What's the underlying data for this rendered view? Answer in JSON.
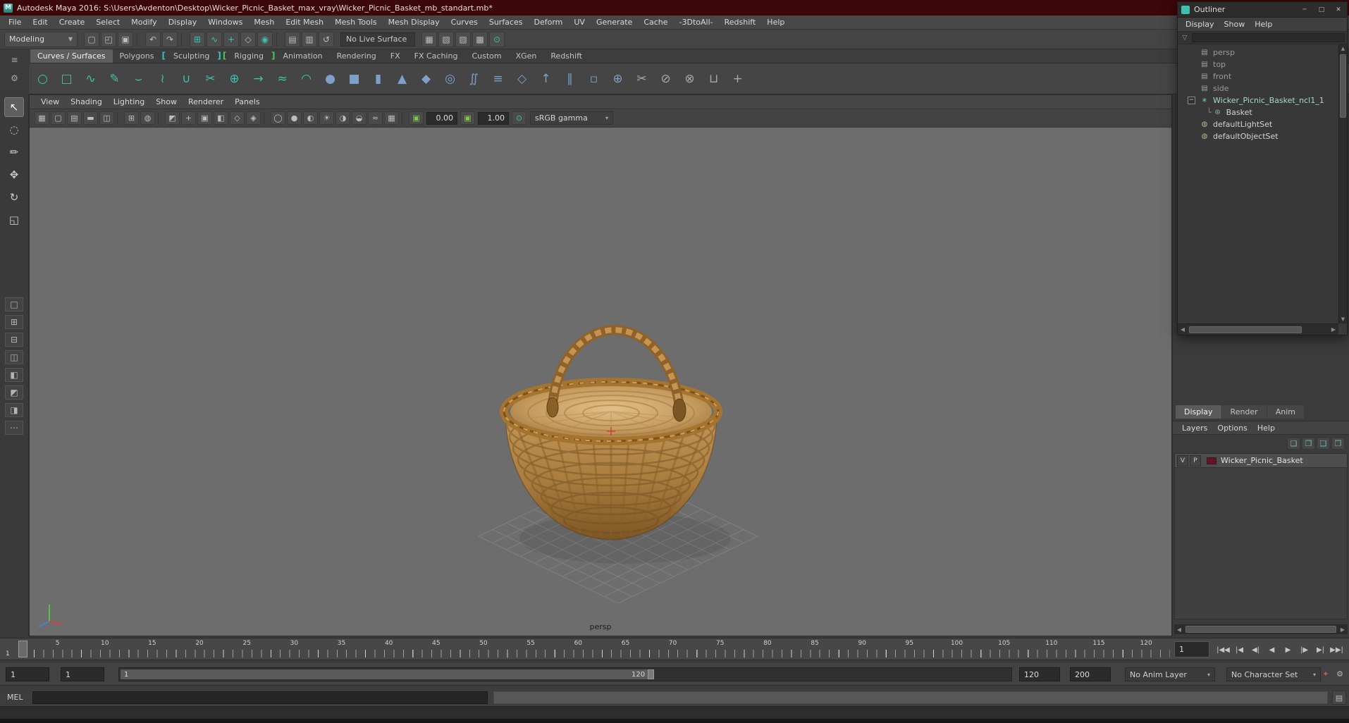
{
  "titlebar": {
    "title": "Autodesk Maya 2016: S:\\Users\\Avdenton\\Desktop\\Wicker_Picnic_Basket_max_vray\\Wicker_Picnic_Basket_mb_standart.mb*",
    "logo_glyph": "M"
  },
  "ui": {
    "dropdown_arrow": "▾",
    "select_arrow": "▼",
    "left_arrow": "◀",
    "right_arrow": "▶",
    "up_arrow": "▲",
    "down_arrow": "▼"
  },
  "colors": {
    "accent_teal": "#3fbfae",
    "titlebar_red": "#3c0708",
    "layer_swatch": "#6b1126",
    "viewport_bg": "#6d6d6d",
    "bracket_green": "#47c94f"
  },
  "menubar": [
    {
      "label": "File",
      "name": "menu-file"
    },
    {
      "label": "Edit",
      "name": "menu-edit"
    },
    {
      "label": "Create",
      "name": "menu-create"
    },
    {
      "label": "Select",
      "name": "menu-select"
    },
    {
      "label": "Modify",
      "name": "menu-modify"
    },
    {
      "label": "Display",
      "name": "menu-display"
    },
    {
      "label": "Windows",
      "name": "menu-windows"
    },
    {
      "label": "Mesh",
      "name": "menu-mesh"
    },
    {
      "label": "Edit Mesh",
      "name": "menu-edit-mesh"
    },
    {
      "label": "Mesh Tools",
      "name": "menu-mesh-tools"
    },
    {
      "label": "Mesh Display",
      "name": "menu-mesh-display"
    },
    {
      "label": "Curves",
      "name": "menu-curves"
    },
    {
      "label": "Surfaces",
      "name": "menu-surfaces"
    },
    {
      "label": "Deform",
      "name": "menu-deform"
    },
    {
      "label": "UV",
      "name": "menu-uv"
    },
    {
      "label": "Generate",
      "name": "menu-generate"
    },
    {
      "label": "Cache",
      "name": "menu-cache"
    },
    {
      "label": "-3DtoAll-",
      "name": "menu-3dtoall"
    },
    {
      "label": "Redshift",
      "name": "menu-redshift"
    },
    {
      "label": "Help",
      "name": "menu-help"
    }
  ],
  "statusline": {
    "mode": "Modeling",
    "live_surface": "No Live Surface",
    "icons": [
      {
        "name": "new-scene-icon",
        "glyph": "▢"
      },
      {
        "name": "open-scene-icon",
        "glyph": "◰"
      },
      {
        "name": "save-scene-icon",
        "glyph": "▣"
      },
      {
        "cls": "sep"
      },
      {
        "name": "undo-icon",
        "glyph": "↶"
      },
      {
        "name": "redo-icon",
        "glyph": "↷"
      },
      {
        "cls": "sep"
      },
      {
        "name": "snap-to-grid-icon",
        "glyph": "⊞",
        "cls": "teal"
      },
      {
        "name": "snap-to-curve-icon",
        "glyph": "∿",
        "cls": "teal"
      },
      {
        "name": "snap-to-point-icon",
        "glyph": "+",
        "cls": "teal"
      },
      {
        "name": "snap-to-view-plane-icon",
        "glyph": "◇"
      },
      {
        "name": "make-live-icon",
        "glyph": "◉",
        "cls": "teal"
      },
      {
        "cls": "sep"
      },
      {
        "name": "input-connections-icon",
        "glyph": "▤"
      },
      {
        "name": "output-connections-icon",
        "glyph": "▥"
      },
      {
        "name": "construction-history-icon",
        "glyph": "↺"
      }
    ],
    "right_icons": [
      {
        "name": "selection-mask-hierarchy-icon",
        "glyph": "▦"
      },
      {
        "name": "selection-mask-object-icon",
        "glyph": "▧"
      },
      {
        "name": "selection-mask-component-icon",
        "glyph": "▨"
      },
      {
        "name": "selection-mask-render-icon",
        "glyph": "▩"
      },
      {
        "name": "highlight-selection-icon",
        "glyph": "⊙",
        "cls": "teal"
      }
    ]
  },
  "shelf": {
    "gutter_icons": [
      {
        "name": "shelf-tab-menu-icon",
        "glyph": "≡"
      },
      {
        "name": "shelf-options-icon",
        "glyph": "⚙"
      }
    ],
    "tabs": [
      {
        "label": "Curves / Surfaces",
        "name": "shelf-tab-curves-surfaces",
        "cls": "active"
      },
      {
        "label": "Polygons",
        "name": "shelf-tab-polygons"
      },
      {
        "label": "[",
        "name": "shelf-bracket",
        "cls": "br teal"
      },
      {
        "label": "Sculpting",
        "name": "shelf-tab-sculpting"
      },
      {
        "label": "]",
        "name": "shelf-bracket",
        "cls": "br teal"
      },
      {
        "label": "[",
        "name": "shelf-bracket",
        "cls": "br green"
      },
      {
        "label": "Rigging",
        "name": "shelf-tab-rigging"
      },
      {
        "label": "]",
        "name": "shelf-bracket",
        "cls": "br green"
      },
      {
        "label": "Animation",
        "name": "shelf-tab-animation"
      },
      {
        "label": "Rendering",
        "name": "shelf-tab-rendering"
      },
      {
        "label": "FX",
        "name": "shelf-tab-fx"
      },
      {
        "label": "FX Caching",
        "name": "shelf-tab-fx-caching"
      },
      {
        "label": "Custom",
        "name": "shelf-tab-custom"
      },
      {
        "label": "XGen",
        "name": "shelf-tab-xgen"
      },
      {
        "label": "Redshift",
        "name": "shelf-tab-redshift"
      }
    ],
    "icons": [
      {
        "name": "nurbs-circle-icon",
        "glyph": "○",
        "cls": "teal"
      },
      {
        "name": "nurbs-square-icon",
        "glyph": "□",
        "cls": "teal"
      },
      {
        "name": "ep-curve-tool-icon",
        "glyph": "∿",
        "cls": "teal"
      },
      {
        "name": "pencil-curve-tool-icon",
        "glyph": "✎",
        "cls": "teal"
      },
      {
        "name": "bezier-curve-tool-icon",
        "glyph": "⌣",
        "cls": "teal"
      },
      {
        "name": "add-points-tool-icon",
        "glyph": "≀",
        "cls": "teal"
      },
      {
        "name": "attach-curves-icon",
        "glyph": "∪",
        "cls": "teal"
      },
      {
        "name": "detach-curves-icon",
        "glyph": "✂",
        "cls": "teal"
      },
      {
        "name": "insert-knot-icon",
        "glyph": "⊕",
        "cls": "teal"
      },
      {
        "name": "extend-curve-icon",
        "glyph": "→",
        "cls": "teal"
      },
      {
        "name": "offset-curve-icon",
        "glyph": "≈",
        "cls": "teal"
      },
      {
        "name": "curve-fillet-icon",
        "glyph": "◠",
        "cls": "teal"
      },
      {
        "name": "nurbs-sphere-icon",
        "glyph": "●",
        "cls": "blue"
      },
      {
        "name": "nurbs-cube-icon",
        "glyph": "■",
        "cls": "blue"
      },
      {
        "name": "nurbs-cylinder-icon",
        "glyph": "▮",
        "cls": "blue"
      },
      {
        "name": "nurbs-cone-icon",
        "glyph": "▲",
        "cls": "blue"
      },
      {
        "name": "nurbs-plane-icon",
        "glyph": "◆",
        "cls": "blue"
      },
      {
        "name": "nurbs-torus-icon",
        "glyph": "◎",
        "cls": "blue"
      },
      {
        "name": "revolve-icon",
        "glyph": "∬",
        "cls": "blue"
      },
      {
        "name": "loft-icon",
        "glyph": "≡",
        "cls": "blue"
      },
      {
        "name": "planar-icon",
        "glyph": "◇",
        "cls": "blue"
      },
      {
        "name": "extrude-surface-icon",
        "glyph": "↑",
        "cls": "blue"
      },
      {
        "name": "birail-icon",
        "glyph": "∥",
        "cls": "blue"
      },
      {
        "name": "boundary-icon",
        "glyph": "▫",
        "cls": "blue"
      },
      {
        "name": "project-curve-icon",
        "glyph": "⊕",
        "cls": "blue"
      },
      {
        "name": "trim-tool-icon",
        "glyph": "✂",
        "cls": "gray"
      },
      {
        "name": "untrim-icon",
        "glyph": "⊘",
        "cls": "gray"
      },
      {
        "name": "intersect-surfaces-icon",
        "glyph": "⊗",
        "cls": "gray"
      },
      {
        "name": "attach-surfaces-icon",
        "glyph": "⊔",
        "cls": "gray"
      },
      {
        "name": "insert-isoparm-icon",
        "glyph": "+",
        "cls": "gray"
      }
    ]
  },
  "toolbox": {
    "tools": [
      {
        "name": "select-tool",
        "glyph": "↖",
        "cls": "active"
      },
      {
        "name": "lasso-select-tool",
        "glyph": "◌"
      },
      {
        "name": "paint-select-tool",
        "glyph": "✏"
      },
      {
        "name": "move-tool",
        "glyph": "✥"
      },
      {
        "name": "rotate-tool",
        "glyph": "↻"
      },
      {
        "name": "scale-tool",
        "glyph": "◱"
      }
    ],
    "layouts": [
      {
        "name": "layout-single-pane",
        "glyph": "□"
      },
      {
        "name": "layout-four-pane",
        "glyph": "⊞"
      },
      {
        "name": "layout-two-pane-stacked",
        "glyph": "⊟"
      },
      {
        "name": "layout-two-pane-side",
        "glyph": "◫"
      },
      {
        "name": "layout-three-pane-top",
        "glyph": "◧"
      },
      {
        "name": "layout-three-pane-left",
        "glyph": "◩"
      },
      {
        "name": "layout-outliner-persp",
        "glyph": "◨"
      },
      {
        "name": "layout-more",
        "glyph": "⋯"
      }
    ]
  },
  "viewport": {
    "menus": [
      {
        "label": "View",
        "name": "panel-menu-view"
      },
      {
        "label": "Shading",
        "name": "panel-menu-shading"
      },
      {
        "label": "Lighting",
        "name": "panel-menu-lighting"
      },
      {
        "label": "Show",
        "name": "panel-menu-show"
      },
      {
        "label": "Renderer",
        "name": "panel-menu-renderer"
      },
      {
        "label": "Panels",
        "name": "panel-menu-panels"
      }
    ],
    "toolbar_icons": [
      {
        "name": "select-camera-icon",
        "glyph": "▦"
      },
      {
        "name": "lock-camera-icon",
        "glyph": "▢"
      },
      {
        "name": "camera-attributes-icon",
        "glyph": "▤"
      },
      {
        "name": "bookmarks-icon",
        "glyph": "▬"
      },
      {
        "name": "image-plane-icon",
        "glyph": "◫"
      },
      {
        "cls": "sep"
      },
      {
        "name": "two-d-pan-zoom-icon",
        "glyph": "⊞"
      },
      {
        "name": "oversampling-icon",
        "glyph": "◍"
      },
      {
        "cls": "sep"
      },
      {
        "name": "isolate-select-icon",
        "glyph": "◩"
      },
      {
        "name": "field-chart-icon",
        "glyph": "+"
      },
      {
        "name": "resolution-gate-icon",
        "glyph": "▣"
      },
      {
        "name": "gate-mask-icon",
        "glyph": "◧"
      },
      {
        "name": "safe-action-icon",
        "glyph": "◇"
      },
      {
        "name": "safe-title-icon",
        "glyph": "◈"
      },
      {
        "cls": "sep"
      },
      {
        "name": "wireframe-icon",
        "glyph": "◯"
      },
      {
        "name": "shaded-icon",
        "glyph": "●"
      },
      {
        "name": "textured-icon",
        "glyph": "◐"
      },
      {
        "name": "use-all-lights-icon",
        "glyph": "☀"
      },
      {
        "name": "shadows-icon",
        "glyph": "◑"
      },
      {
        "name": "screen-space-ao-icon",
        "glyph": "◒"
      },
      {
        "name": "motion-blur-icon",
        "glyph": "≈"
      },
      {
        "name": "multisample-icon",
        "glyph": "▦"
      },
      {
        "cls": "sep"
      }
    ],
    "exposure_icon_glyph": "▣",
    "exposure": "0.00",
    "gamma_icon_glyph": "▣",
    "gamma": "1.00",
    "material_icon_glyph": "⊙",
    "color_transform": "sRGB gamma",
    "camera_label": "persp"
  },
  "outliner": {
    "title": "Outliner",
    "window_buttons": [
      {
        "name": "minimize-button",
        "glyph": "─"
      },
      {
        "name": "maximize-button",
        "glyph": "□"
      },
      {
        "name": "close-button",
        "glyph": "✕"
      }
    ],
    "menus": [
      {
        "label": "Display",
        "name": "outliner-menu-display"
      },
      {
        "label": "Show",
        "name": "outliner-menu-show"
      },
      {
        "label": "Help",
        "name": "outliner-menu-help"
      }
    ],
    "filter_glyph": "▽",
    "items": [
      {
        "name": "outliner-item-persp",
        "label": "persp",
        "icon": "▤",
        "cls": "cam"
      },
      {
        "name": "outliner-item-top",
        "label": "top",
        "icon": "▤",
        "cls": "cam"
      },
      {
        "name": "outliner-item-front",
        "label": "front",
        "icon": "▤",
        "cls": "cam"
      },
      {
        "name": "outliner-item-side",
        "label": "side",
        "icon": "▤",
        "cls": "cam"
      },
      {
        "name": "outliner-item-wicker-picnic-basket-ncl1-1",
        "label": "Wicker_Picnic_Basket_ncl1_1",
        "icon": "∗",
        "cls": "ncl expandable",
        "exp": "−"
      },
      {
        "name": "outliner-item-basket",
        "label": "Basket",
        "icon": "⊛",
        "cls": "child",
        "conn": "└"
      },
      {
        "name": "outliner-item-default-light-set",
        "label": "defaultLightSet",
        "icon": "◍",
        "cls": "set"
      },
      {
        "name": "outliner-item-default-object-set",
        "label": "defaultObjectSet",
        "icon": "◍",
        "cls": "set"
      }
    ]
  },
  "layer_editor": {
    "tabs": [
      {
        "label": "Display",
        "name": "tab-display",
        "cls": "active"
      },
      {
        "label": "Render",
        "name": "tab-render"
      },
      {
        "label": "Anim",
        "name": "tab-anim"
      }
    ],
    "menus": [
      {
        "label": "Layers",
        "name": "layer-menu-layers"
      },
      {
        "label": "Options",
        "name": "layer-menu-options"
      },
      {
        "label": "Help",
        "name": "layer-menu-help"
      }
    ],
    "toolbar_icons": [
      {
        "name": "layer-move-up-icon",
        "glyph": "❏"
      },
      {
        "name": "layer-move-down-icon",
        "glyph": "❐"
      },
      {
        "name": "create-empty-layer-icon",
        "glyph": "❑"
      },
      {
        "name": "create-layer-from-selected-icon",
        "glyph": "❒"
      }
    ],
    "layers": [
      {
        "name": "layer-row-wicker-picnic-basket",
        "visible": "V",
        "playback": "P",
        "label": "Wicker_Picnic_Basket"
      }
    ]
  },
  "timeline": {
    "ticks": [
      "5",
      "10",
      "15",
      "20",
      "25",
      "30",
      "35",
      "40",
      "45",
      "50",
      "55",
      "60",
      "65",
      "70",
      "75",
      "80",
      "85",
      "90",
      "95",
      "100",
      "105",
      "110",
      "115",
      "120"
    ],
    "current_frame": "1",
    "current_frame_field": "1",
    "playback_buttons": [
      {
        "name": "go-to-start-button",
        "glyph": "|◀◀"
      },
      {
        "name": "step-back-key-button",
        "glyph": "|◀"
      },
      {
        "name": "step-back-frame-button",
        "glyph": "◀|"
      },
      {
        "name": "play-backward-button",
        "glyph": "◀"
      },
      {
        "name": "play-forward-button",
        "glyph": "▶"
      },
      {
        "name": "step-forward-frame-button",
        "glyph": "|▶"
      },
      {
        "name": "step-forward-key-button",
        "glyph": "▶|"
      },
      {
        "name": "go-to-end-button",
        "glyph": "▶▶|"
      }
    ]
  },
  "range_slider": {
    "anim_start": "1",
    "playback_start": "1",
    "bar_start_label": "1",
    "bar_end_label": "120",
    "playback_end": "120",
    "anim_end": "200",
    "anim_layer": "No Anim Layer",
    "character_set": "No Character Set",
    "icons": [
      {
        "name": "auto-keyframe-icon",
        "glyph": "✦",
        "cls": "red"
      },
      {
        "name": "animation-preferences-icon",
        "glyph": "⚙"
      }
    ]
  },
  "command_line": {
    "label": "MEL",
    "input_value": "",
    "result_value": "",
    "script_editor_glyph": "▤"
  }
}
